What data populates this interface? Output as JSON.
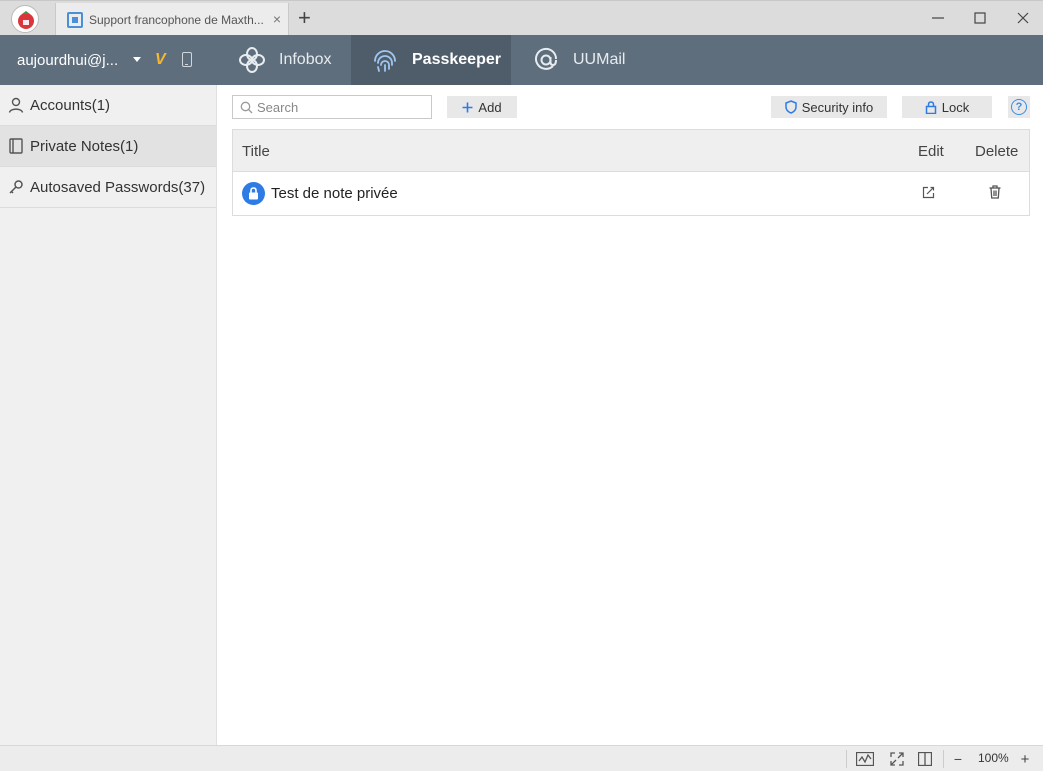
{
  "browser": {
    "tab": {
      "title": "Support francophone de Maxth...",
      "close_label": "×"
    },
    "new_tab_label": "+",
    "window": {
      "minimize": "—",
      "maximize": "☐",
      "close": "✕"
    }
  },
  "navbar": {
    "account": "aujourdhui@j...",
    "vip_badge": "V",
    "tabs": [
      {
        "label": "Infobox",
        "icon": "infobox-icon",
        "active": false
      },
      {
        "label": "Passkeeper",
        "icon": "fingerprint-icon",
        "active": true
      },
      {
        "label": "UUMail",
        "icon": "mail-at-icon",
        "active": false
      }
    ]
  },
  "sidebar": {
    "items": [
      {
        "label": "Accounts(1)",
        "icon": "user-icon",
        "selected": false
      },
      {
        "label": "Private Notes(1)",
        "icon": "notebook-icon",
        "selected": true
      },
      {
        "label": "Autosaved Passwords(37)",
        "icon": "key-icon",
        "selected": false
      }
    ]
  },
  "toolbar": {
    "search_placeholder": "Search",
    "add_label": "Add",
    "security_label": "Security info",
    "lock_label": "Lock",
    "help_label": "?"
  },
  "table": {
    "columns": {
      "title": "Title",
      "edit": "Edit",
      "delete": "Delete"
    },
    "rows": [
      {
        "title": "Test de note privée",
        "icon": "lock-icon"
      }
    ]
  },
  "statusbar": {
    "zoom": "100%",
    "zoom_out": "−",
    "zoom_in": "+"
  },
  "colors": {
    "navbar": "#5f6e7d",
    "navbar_active": "#4f5c69",
    "accent": "#2d7be5",
    "vip": "#f5b82e"
  }
}
